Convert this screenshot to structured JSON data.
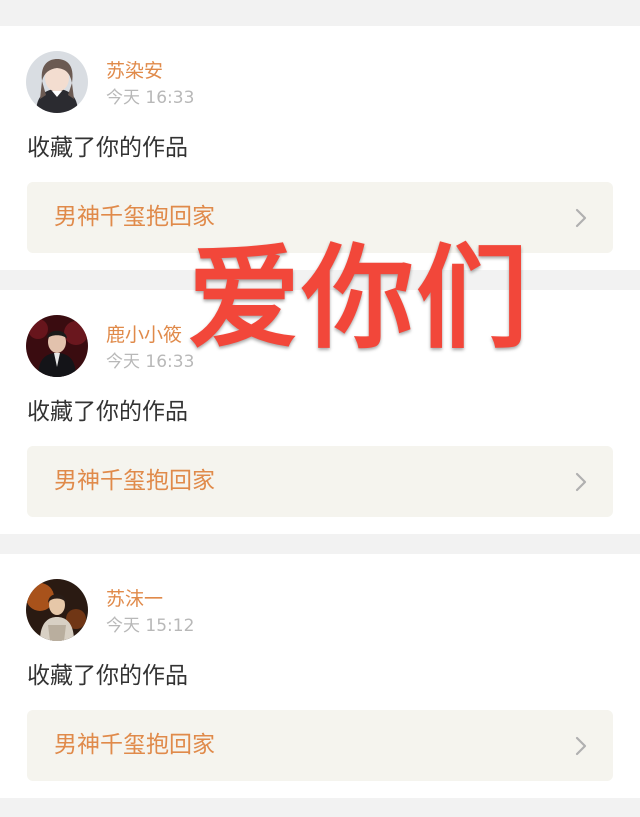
{
  "notifications": [
    {
      "username": "苏染安",
      "time": "今天 16:33",
      "action": "收藏了你的作品",
      "work_title": "男神千玺抱回家",
      "avatar_icon": "user-avatar-girl"
    },
    {
      "username": "鹿小小筱",
      "time": "今天 16:33",
      "action": "收藏了你的作品",
      "work_title": "男神千玺抱回家",
      "avatar_icon": "user-avatar-suit"
    },
    {
      "username": "苏沫一",
      "time": "今天 15:12",
      "action": "收藏了你的作品",
      "work_title": "男神千玺抱回家",
      "avatar_icon": "user-avatar-stage"
    }
  ],
  "overlay_text": "爱你们",
  "colors": {
    "accent": "#e08a4a",
    "overlay": "#f2473a",
    "timestamp": "#b8b8b8",
    "work_box_bg": "#f5f4ee",
    "divider_bg": "#f2f2f2"
  }
}
